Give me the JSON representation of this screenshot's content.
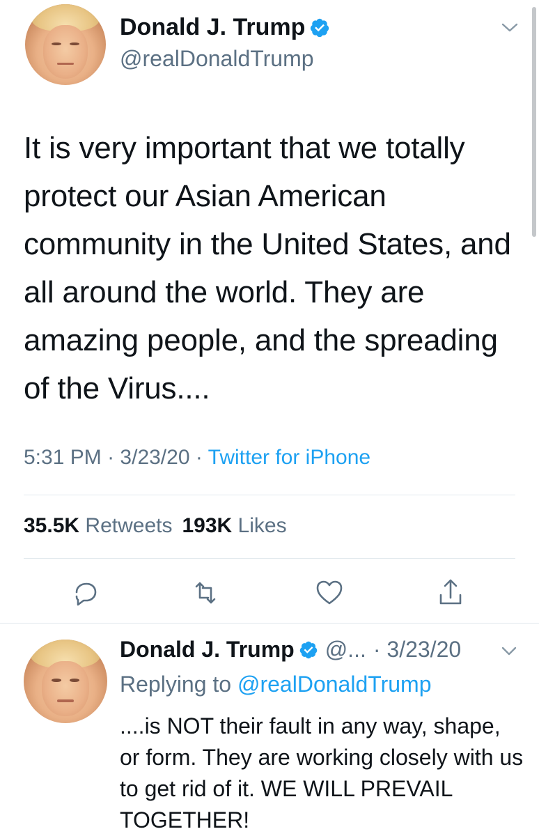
{
  "main_tweet": {
    "author_name": "Donald J. Trump",
    "handle": "@realDonaldTrump",
    "text": "It is very important that we totally protect our Asian American community in the United States, and all around the world. They are amazing people, and the spreading of the Virus....",
    "time": "5:31 PM",
    "date": "3/23/20",
    "separator": "·",
    "source": "Twitter for iPhone",
    "retweets_count": "35.5K",
    "retweets_label": "Retweets",
    "likes_count": "193K",
    "likes_label": "Likes",
    "icons": {
      "verified": "verified-badge-icon",
      "menu": "chevron-down-icon",
      "reply": "reply-icon",
      "retweet": "retweet-icon",
      "like": "heart-icon",
      "share": "share-icon"
    }
  },
  "reply_tweet": {
    "author_name": "Donald J. Trump",
    "handle": "@...",
    "date_text": "· 3/23/20",
    "replying_prefix": "Replying to",
    "replying_to": "@realDonaldTrump",
    "text": "....is NOT their fault in any way, shape, or form. They are working closely with us to get rid of it. WE WILL PREVAIL TOGETHER!"
  },
  "colors": {
    "accent": "#1da1f2",
    "secondary_text": "#5b7083",
    "primary_text": "#0f1419",
    "divider": "#e1e8ed"
  }
}
